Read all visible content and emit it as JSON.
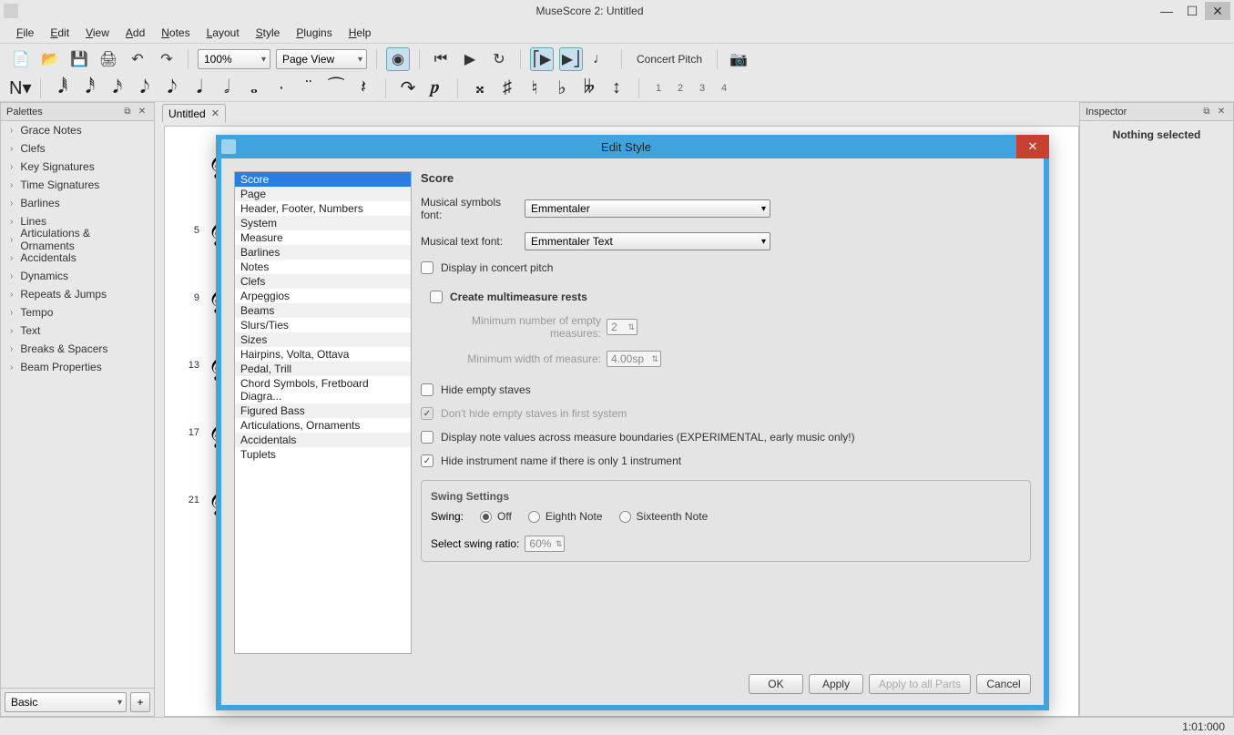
{
  "window": {
    "title": "MuseScore 2: Untitled"
  },
  "menu": [
    "File",
    "Edit",
    "View",
    "Add",
    "Notes",
    "Layout",
    "Style",
    "Plugins",
    "Help"
  ],
  "toolbar": {
    "zoom": "100%",
    "view_mode": "Page View",
    "concert_pitch": "Concert Pitch"
  },
  "voices": [
    "1",
    "2",
    "3",
    "4"
  ],
  "palettes": {
    "title": "Palettes",
    "items": [
      "Grace Notes",
      "Clefs",
      "Key Signatures",
      "Time Signatures",
      "Barlines",
      "Lines",
      "Articulations & Ornaments",
      "Accidentals",
      "Dynamics",
      "Repeats & Jumps",
      "Tempo",
      "Text",
      "Breaks & Spacers",
      "Beam Properties"
    ],
    "preset": "Basic"
  },
  "document": {
    "tab_label": "Untitled",
    "measure_numbers": [
      "",
      "5",
      "9",
      "13",
      "17",
      "21"
    ]
  },
  "inspector": {
    "title": "Inspector",
    "message": "Nothing selected"
  },
  "status": {
    "position": "1:01:000"
  },
  "dialog": {
    "title": "Edit Style",
    "categories": [
      "Score",
      "Page",
      "Header, Footer, Numbers",
      "System",
      "Measure",
      "Barlines",
      "Notes",
      "Clefs",
      "Arpeggios",
      "Beams",
      "Slurs/Ties",
      "Sizes",
      "Hairpins, Volta, Ottava",
      "Pedal, Trill",
      "Chord Symbols, Fretboard Diagra...",
      "Figured Bass",
      "Articulations, Ornaments",
      "Accidentals",
      "Tuplets"
    ],
    "selected_category": "Score",
    "score": {
      "heading": "Score",
      "symbols_font_label": "Musical symbols font:",
      "symbols_font": "Emmentaler",
      "text_font_label": "Musical text font:",
      "text_font": "Emmentaler Text",
      "display_concert_pitch": "Display in concert pitch",
      "create_mm_rests": "Create multimeasure rests",
      "min_empty_label": "Minimum number of empty measures:",
      "min_empty": "2",
      "min_width_label": "Minimum width of measure:",
      "min_width": "4.00sp",
      "hide_empty_staves": "Hide empty staves",
      "dont_hide_first": "Don't hide empty staves in first system",
      "display_values_across": "Display note values across measure boundaries (EXPERIMENTAL, early music only!)",
      "hide_instrument_name": "Hide instrument name if there is only 1 instrument",
      "swing_heading": "Swing Settings",
      "swing_label": "Swing:",
      "swing_options": [
        "Off",
        "Eighth Note",
        "Sixteenth Note"
      ],
      "swing_ratio_label": "Select swing ratio:",
      "swing_ratio": "60%"
    },
    "buttons": {
      "ok": "OK",
      "apply": "Apply",
      "apply_all": "Apply to all Parts",
      "cancel": "Cancel"
    }
  }
}
